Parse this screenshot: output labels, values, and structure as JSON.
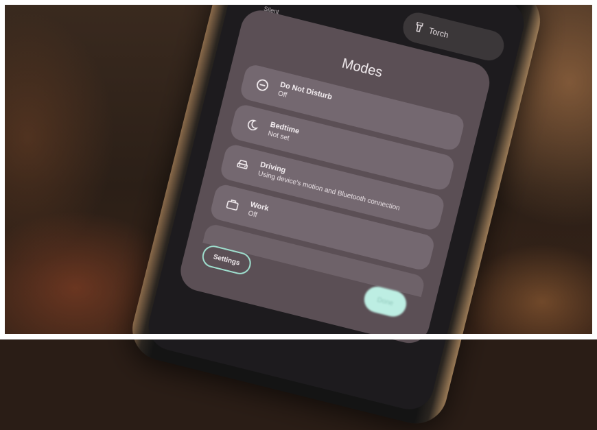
{
  "quick_settings": {
    "torch_label": "Torch",
    "silent_label": "Silent"
  },
  "modes_sheet": {
    "title": "Modes",
    "items": [
      {
        "name": "Do Not Disturb",
        "status": "Off",
        "icon": "do-not-disturb-icon"
      },
      {
        "name": "Bedtime",
        "status": "Not set",
        "icon": "moon-icon"
      },
      {
        "name": "Driving",
        "status": "Using device's motion and Bluetooth connection",
        "icon": "car-icon"
      },
      {
        "name": "Work",
        "status": "Off",
        "icon": "briefcase-icon"
      }
    ],
    "settings_label": "Settings",
    "done_label": "Done"
  },
  "colors": {
    "sheet_bg": "#5b4f55",
    "card_bg": "#746870",
    "accent_outline": "#9fe0cf",
    "done_bg": "#bdeee3"
  }
}
